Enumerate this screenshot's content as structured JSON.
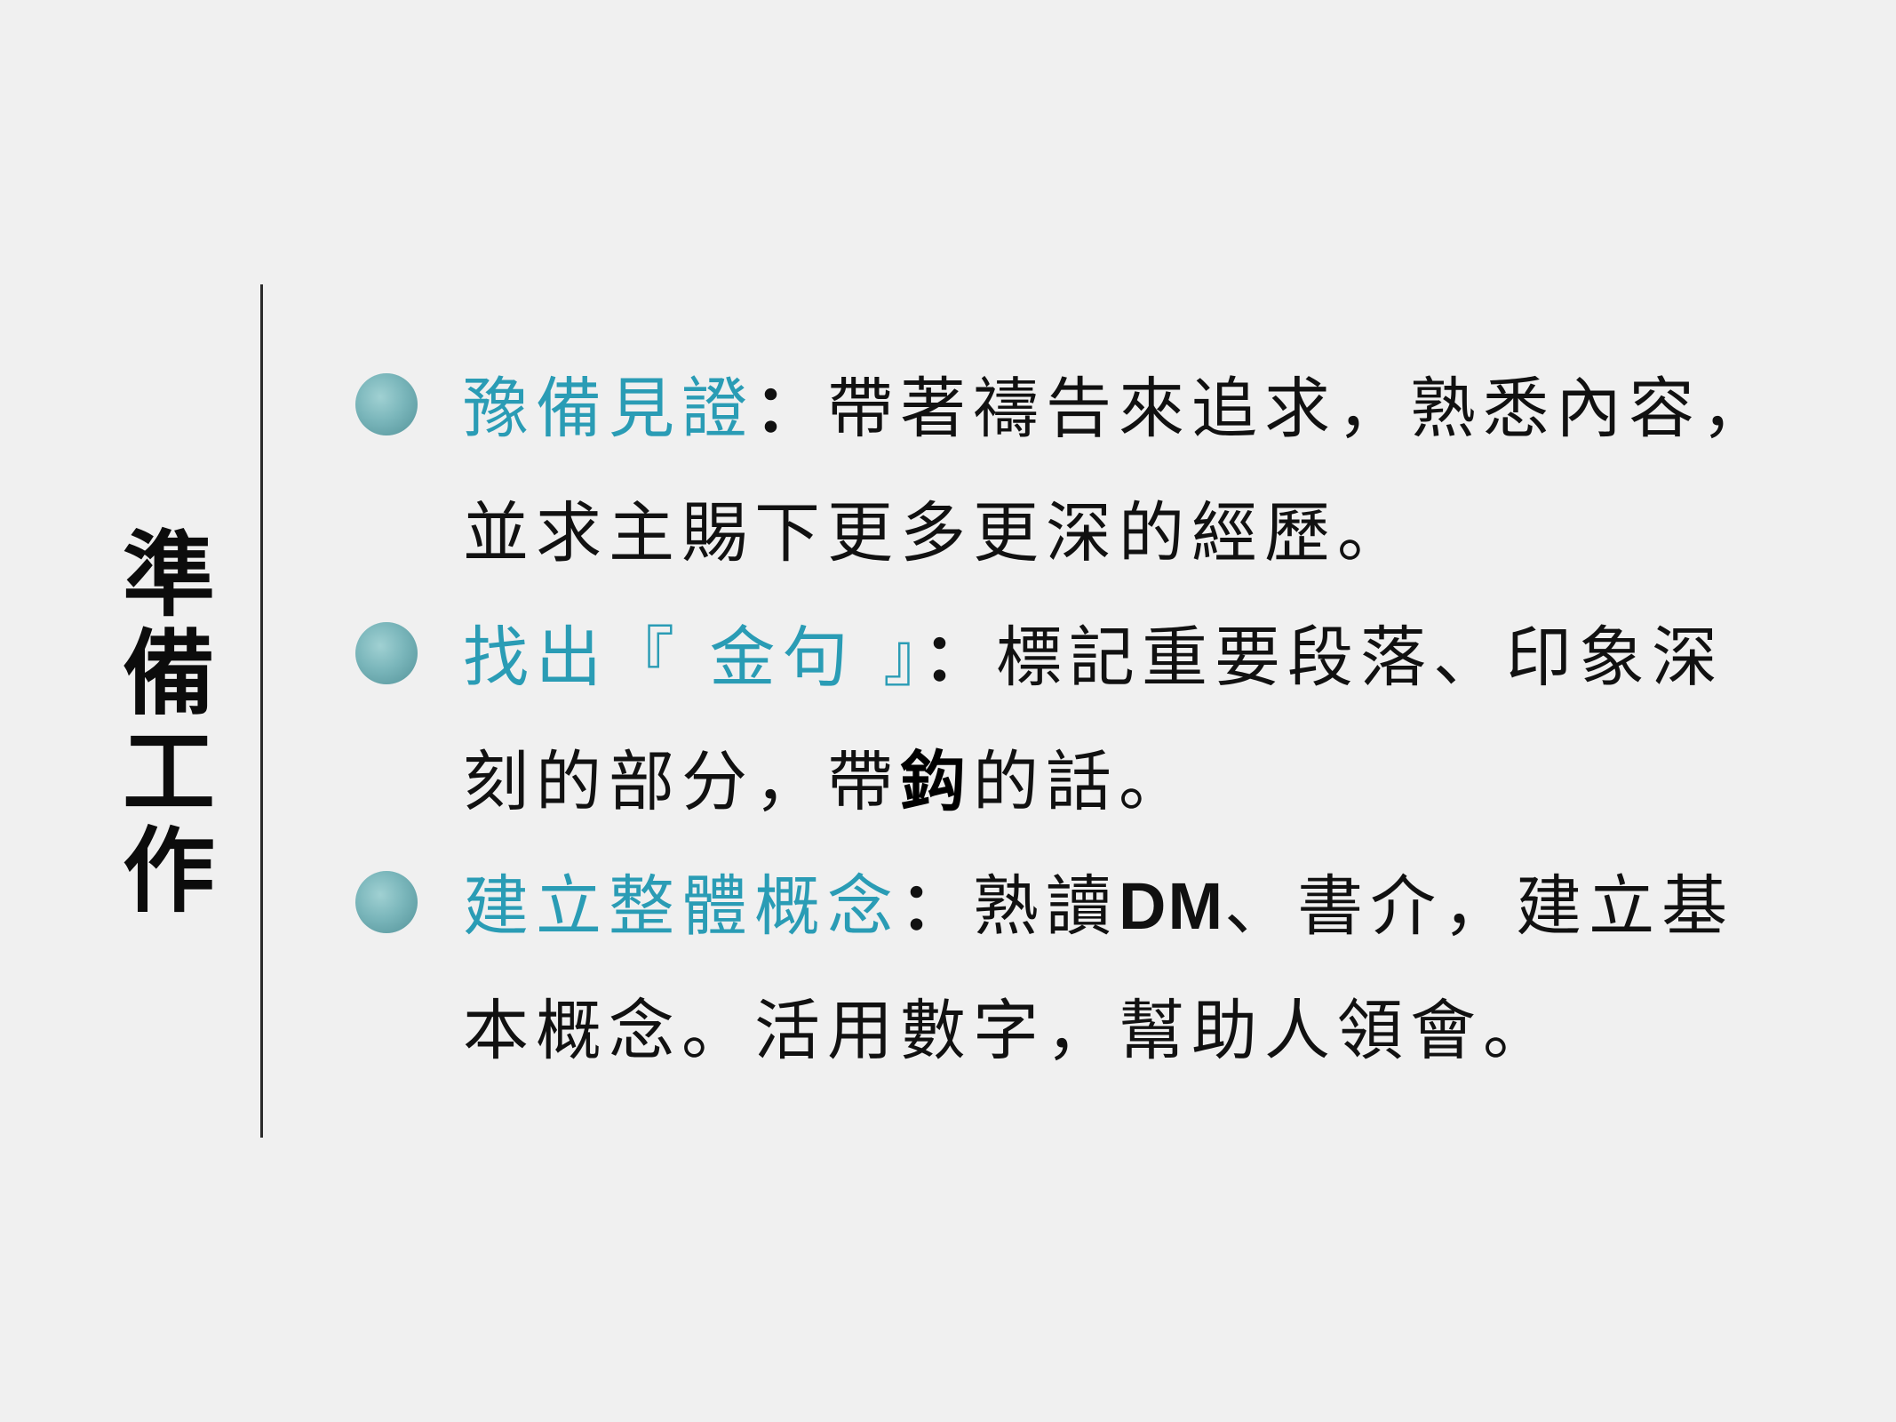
{
  "title_chars": [
    "準",
    "備",
    "工",
    "作"
  ],
  "colors": {
    "background": "#f0f0f0",
    "heading_accent": "#2a9cb5",
    "bullet_dot": "#74b3b8",
    "body_text": "#111111"
  },
  "bullets": [
    {
      "heading": "豫備見證",
      "colon": "：",
      "text": "帶著禱告來追求，熟悉內容，並求主賜下更多更深的經歷。"
    },
    {
      "heading": "找出『 金句 』",
      "colon": "：",
      "text": "標記重要段落、印象深刻的部分，帶",
      "emphasis": "鈎",
      "text_after": "的話。"
    },
    {
      "heading": "建立整體概念",
      "colon": "：",
      "text_before": "熟讀",
      "latin": "DM",
      "text": "、書介，建立基本概念。活用數字，幫助人領會。"
    }
  ]
}
